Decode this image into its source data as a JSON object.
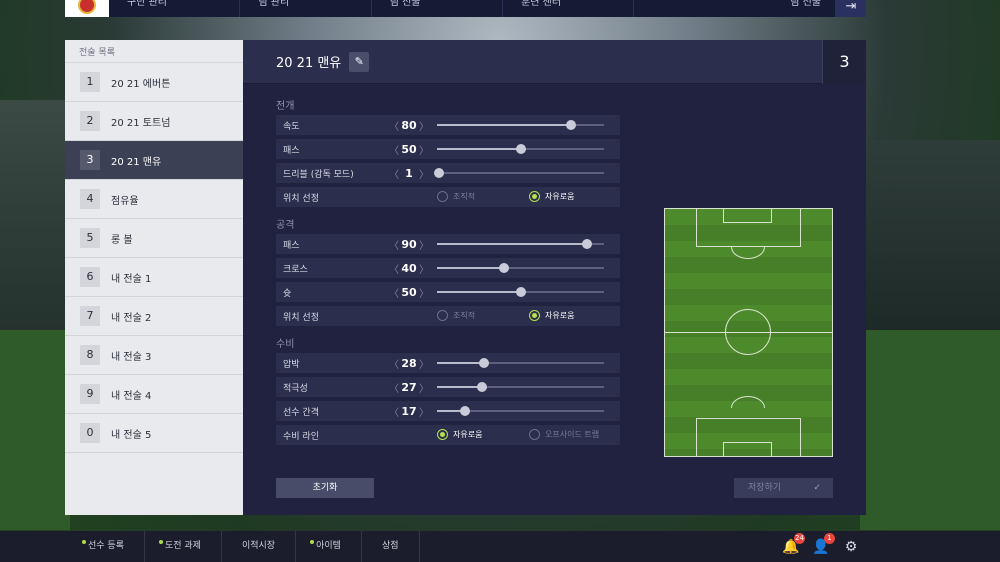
{
  "topnav": {
    "tabs": [
      "구단 관리",
      "팀 관리",
      "팀 전술",
      "훈련 센터"
    ],
    "right_label": "팀 전술"
  },
  "sidebar": {
    "title": "전술 목록",
    "items": [
      {
        "num": "1",
        "label": "20 21 에버튼"
      },
      {
        "num": "2",
        "label": "20 21 토트넘"
      },
      {
        "num": "3",
        "label": "20 21 맨유"
      },
      {
        "num": "4",
        "label": "점유율"
      },
      {
        "num": "5",
        "label": "롱 볼"
      },
      {
        "num": "6",
        "label": "내 전술 1"
      },
      {
        "num": "7",
        "label": "내 전술 2"
      },
      {
        "num": "8",
        "label": "내 전술 3"
      },
      {
        "num": "9",
        "label": "내 전술 4"
      },
      {
        "num": "0",
        "label": "내 전술 5"
      }
    ],
    "active_index": 2
  },
  "main": {
    "title": "20 21 맨유",
    "number": "3",
    "sections": {
      "build": {
        "title": "전개",
        "speed": {
          "label": "속도",
          "value": "80"
        },
        "pass": {
          "label": "패스",
          "value": "50"
        },
        "dribble": {
          "label": "드리블 (감독 모드)",
          "value": "1"
        },
        "position": {
          "label": "위치 선정",
          "option1": "조직적",
          "option2": "자유로움"
        }
      },
      "attack": {
        "title": "공격",
        "pass": {
          "label": "패스",
          "value": "90"
        },
        "cross": {
          "label": "크로스",
          "value": "40"
        },
        "shoot": {
          "label": "슛",
          "value": "50"
        },
        "position": {
          "label": "위치 선정",
          "option1": "조직적",
          "option2": "자유로움"
        }
      },
      "defense": {
        "title": "수비",
        "pressure": {
          "label": "압박",
          "value": "28"
        },
        "aggression": {
          "label": "적극성",
          "value": "27"
        },
        "width": {
          "label": "선수 간격",
          "value": "17"
        },
        "line": {
          "label": "수비 라인",
          "option1": "자유로움",
          "option2": "오프사이드 트랩"
        }
      }
    },
    "reset_label": "초기화",
    "save_label": "저장하기"
  },
  "bottombar": {
    "items": [
      "선수 등록",
      "도전 과제",
      "이적시장",
      "아이템",
      "상점"
    ],
    "notif_count": "24",
    "profile_count": "1"
  }
}
